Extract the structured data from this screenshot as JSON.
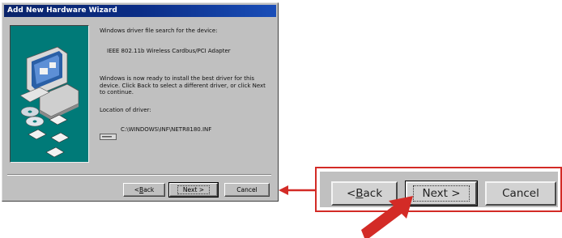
{
  "dialog": {
    "title": "Add New Hardware Wizard",
    "lines": {
      "search_heading": "Windows driver file search for the device:",
      "device_name": "IEEE 802.11b Wireless Cardbus/PCI Adapter",
      "ready_text": "Windows is now ready to install the best driver for this\ndevice. Click Back to select a different driver, or click Next\nto continue.",
      "location_label": "Location of driver:",
      "driver_path": "C:\\WINDOWS\\INF\\NETR8180.INF"
    },
    "buttons": {
      "back_prefix": "< ",
      "back_accel": "B",
      "back_rest": "ack",
      "next": "Next >",
      "cancel": "Cancel"
    }
  },
  "zoom": {
    "back_prefix": "< ",
    "back_accel": "B",
    "back_rest": "ack",
    "next": "Next >",
    "cancel": "Cancel"
  },
  "colors": {
    "titlebar": "#0a246a",
    "dialog_face": "#c0c0c0",
    "illustration_bg": "#007a78",
    "callout_red": "#d32b26"
  },
  "icons": {
    "computer": "computer-icon",
    "cd": "cd-icon",
    "drive": "drive-icon",
    "arrow": "arrow-icon"
  }
}
